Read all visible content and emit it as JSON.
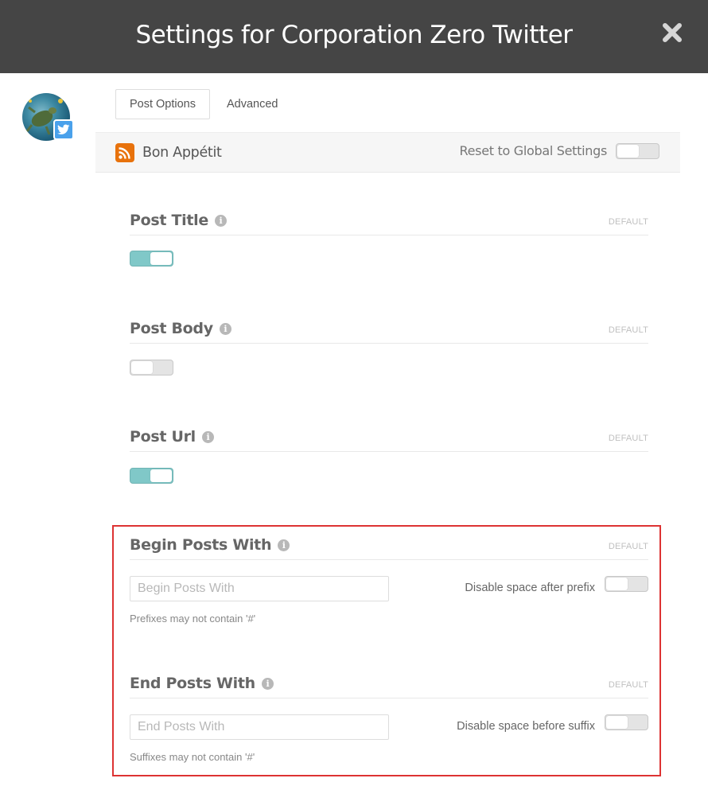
{
  "header": {
    "title": "Settings for Corporation Zero Twitter",
    "close_icon": "close-icon"
  },
  "account": {
    "avatar_icon": "avatar",
    "badge_icon": "twitter-icon",
    "badge_color": "#4aa1eb"
  },
  "tabs": [
    {
      "label": "Post Options",
      "active": true
    },
    {
      "label": "Advanced",
      "active": false
    }
  ],
  "feed": {
    "icon": "rss-icon",
    "icon_color": "#e8720c",
    "name": "Bon Appétit",
    "reset_label": "Reset to Global Settings",
    "reset_enabled": false
  },
  "sections": [
    {
      "label": "Post Title",
      "default_label": "DEFAULT",
      "enabled": true
    },
    {
      "label": "Post Body",
      "default_label": "DEFAULT",
      "enabled": false
    },
    {
      "label": "Post Url",
      "default_label": "DEFAULT",
      "enabled": true
    }
  ],
  "begin_posts": {
    "label": "Begin Posts With",
    "default_label": "DEFAULT",
    "input_placeholder": "Begin Posts With",
    "input_value": "",
    "option_label": "Disable space after prefix",
    "option_enabled": false,
    "hint": "Prefixes may not contain '#'"
  },
  "end_posts": {
    "label": "End Posts With",
    "default_label": "DEFAULT",
    "input_placeholder": "End Posts With",
    "input_value": "",
    "option_label": "Disable space before suffix",
    "option_enabled": false,
    "hint": "Suffixes may not contain '#'"
  },
  "colors": {
    "header_bg": "#454545",
    "toggle_on": "#80c8c8",
    "highlight_border": "#dd3333"
  }
}
